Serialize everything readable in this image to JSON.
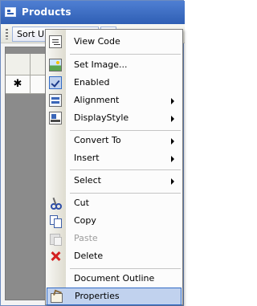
{
  "window": {
    "title": "Products",
    "toolbar_button_label": "Sort Unit Price Asc"
  },
  "grid": {
    "new_row_marker": "✱"
  },
  "context_menu": {
    "items": [
      {
        "label": "View Code",
        "icon": "view-code-icon"
      },
      {
        "label": "Set Image...",
        "icon": "image-icon"
      },
      {
        "label": "Enabled",
        "icon": "checkmark-icon",
        "checked": true
      },
      {
        "label": "Alignment",
        "icon": "alignment-icon",
        "submenu": true
      },
      {
        "label": "DisplayStyle",
        "icon": "display-style-icon",
        "submenu": true
      },
      {
        "label": "Convert To",
        "submenu": true
      },
      {
        "label": "Insert",
        "submenu": true
      },
      {
        "label": "Select",
        "submenu": true
      },
      {
        "label": "Cut",
        "icon": "scissors-icon"
      },
      {
        "label": "Copy",
        "icon": "copy-icon"
      },
      {
        "label": "Paste",
        "icon": "paste-icon",
        "disabled": true
      },
      {
        "label": "Delete",
        "icon": "delete-icon"
      },
      {
        "label": "Document Outline"
      },
      {
        "label": "Properties",
        "icon": "properties-icon",
        "highlighted": true
      }
    ]
  },
  "colors": {
    "title_bar": "#2f5fb4",
    "menu_highlight": "#c1d2ee",
    "menu_highlight_border": "#316ac5",
    "delete_icon": "#d42020"
  }
}
